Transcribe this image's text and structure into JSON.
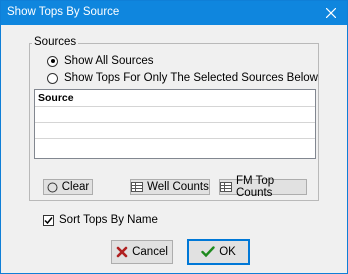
{
  "window": {
    "title": "Show Tops By Source",
    "close_icon": "close-icon"
  },
  "sources_group": {
    "legend": "Sources",
    "radio_all": {
      "label": "Show All Sources",
      "checked": true
    },
    "radio_selected": {
      "label": "Show Tops For Only The Selected Sources Below",
      "checked": false
    },
    "table": {
      "columns": [
        "Source"
      ],
      "rows": []
    },
    "buttons": {
      "clear": "Clear",
      "well_counts": "Well Counts",
      "fm_top_counts": "FM Top Counts"
    }
  },
  "sort_checkbox": {
    "label": "Sort Tops By Name",
    "checked": true
  },
  "footer": {
    "cancel": "Cancel",
    "ok": "OK"
  },
  "colors": {
    "titlebar": "#0f86de",
    "cancel_icon": "#b02020",
    "ok_icon": "#1e8a1e"
  }
}
